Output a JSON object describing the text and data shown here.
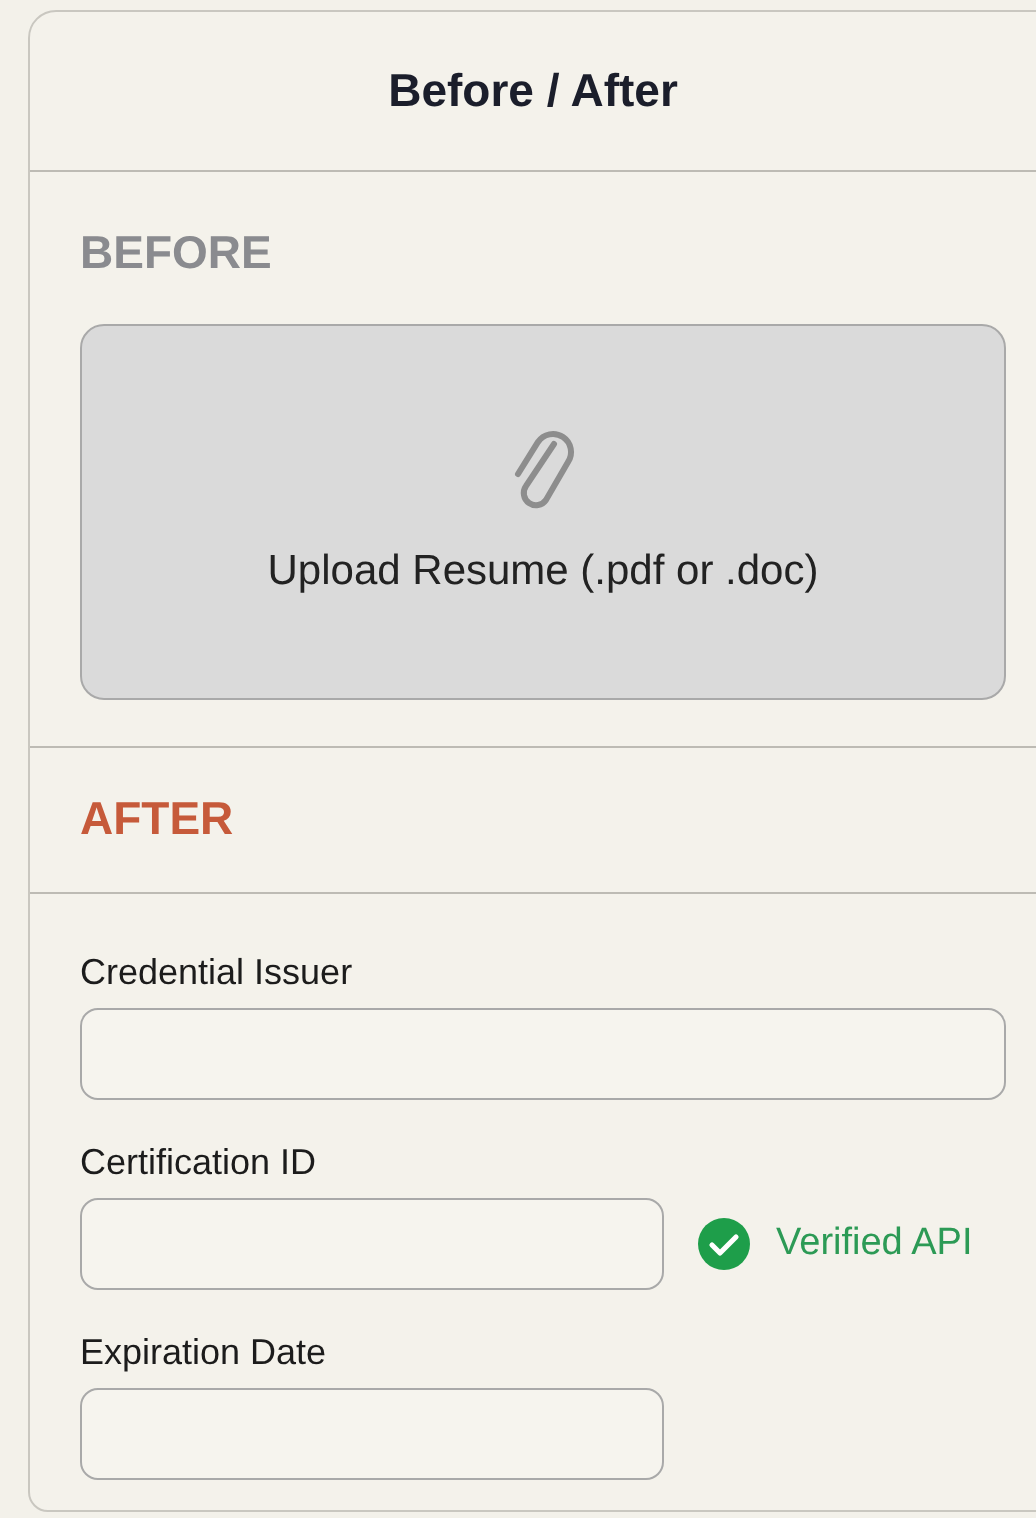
{
  "title": "Before / After",
  "before": {
    "heading": "BEFORE",
    "upload": {
      "label": "Upload Resume (.pdf or .doc)"
    }
  },
  "after": {
    "heading": "AFTER",
    "fields": [
      {
        "label": "Credential Issuer",
        "kind": "wide"
      },
      {
        "label": "Certification ID",
        "kind": "half",
        "badge": "Verified API"
      },
      {
        "label": "Expiration Date",
        "kind": "half"
      }
    ]
  }
}
